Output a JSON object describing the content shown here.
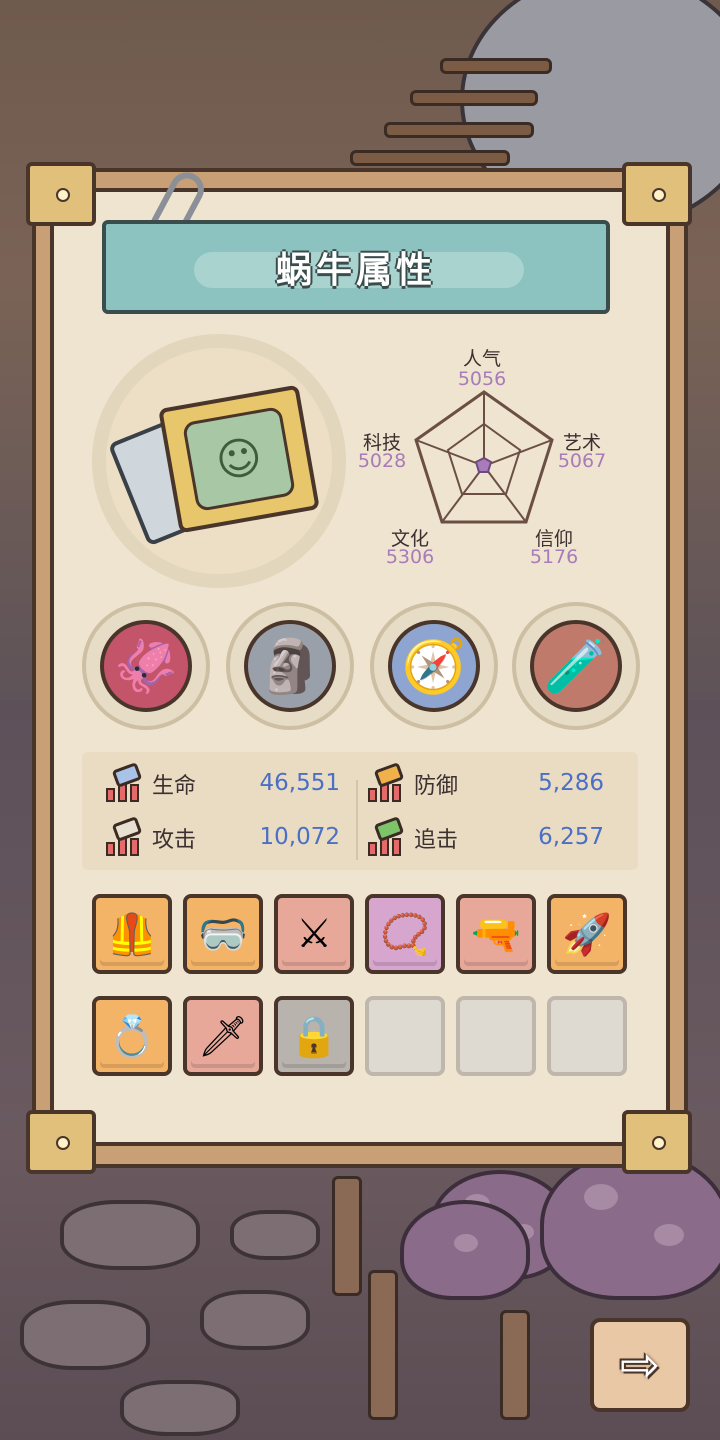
{
  "title": "蜗牛属性",
  "radar": {
    "axes": [
      {
        "key": "popularity",
        "label": "人气",
        "value": "5056"
      },
      {
        "key": "art",
        "label": "艺术",
        "value": "5067"
      },
      {
        "key": "faith",
        "label": "信仰",
        "value": "5176"
      },
      {
        "key": "culture",
        "label": "文化",
        "value": "5306"
      },
      {
        "key": "tech",
        "label": "科技",
        "value": "5028"
      }
    ]
  },
  "relics": [
    {
      "name": "tentacle-relic",
      "glyph": "🦑",
      "color": "#c4546a"
    },
    {
      "name": "stone-head-relic",
      "glyph": "🗿",
      "color": "#9aa0aa"
    },
    {
      "name": "compass-relic",
      "glyph": "🧭",
      "color": "#8ea5d1"
    },
    {
      "name": "potion-crate-relic",
      "glyph": "🧪",
      "color": "#c07a6b"
    }
  ],
  "stats": {
    "hp": {
      "label": "生命",
      "value": "46,551"
    },
    "defense": {
      "label": "防御",
      "value": "5,286"
    },
    "attack": {
      "label": "攻击",
      "value": "10,072"
    },
    "chase": {
      "label": "追击",
      "value": "6,257"
    }
  },
  "equipment": [
    {
      "name": "vest-item",
      "glyph": "🦺",
      "rarity": "orange"
    },
    {
      "name": "goggles-item",
      "glyph": "🥽",
      "rarity": "orange"
    },
    {
      "name": "crossed-swords-item",
      "glyph": "⚔",
      "rarity": "pink"
    },
    {
      "name": "necklace-item",
      "glyph": "📿",
      "rarity": "purple"
    },
    {
      "name": "blaster-item",
      "glyph": "🔫",
      "rarity": "pink"
    },
    {
      "name": "rocket-item",
      "glyph": "🚀",
      "rarity": "orange"
    },
    {
      "name": "ring-item",
      "glyph": "💍",
      "rarity": "orange"
    },
    {
      "name": "dagger-item",
      "glyph": "🗡",
      "rarity": "pink"
    },
    {
      "name": "locked-slot",
      "glyph": "🔒",
      "rarity": "gray"
    },
    {
      "name": "empty-slot",
      "glyph": "",
      "rarity": "empty"
    },
    {
      "name": "empty-slot",
      "glyph": "",
      "rarity": "empty"
    },
    {
      "name": "empty-slot",
      "glyph": "",
      "rarity": "empty"
    }
  ],
  "next_button": {
    "icon": "right-arrow-icon",
    "glyph": "⇨"
  },
  "colors": {
    "panel": "#efe4cf",
    "title_board": "#8cc2bf",
    "stat_value": "#4a6fc4",
    "radar_value": "#a87cb8"
  }
}
